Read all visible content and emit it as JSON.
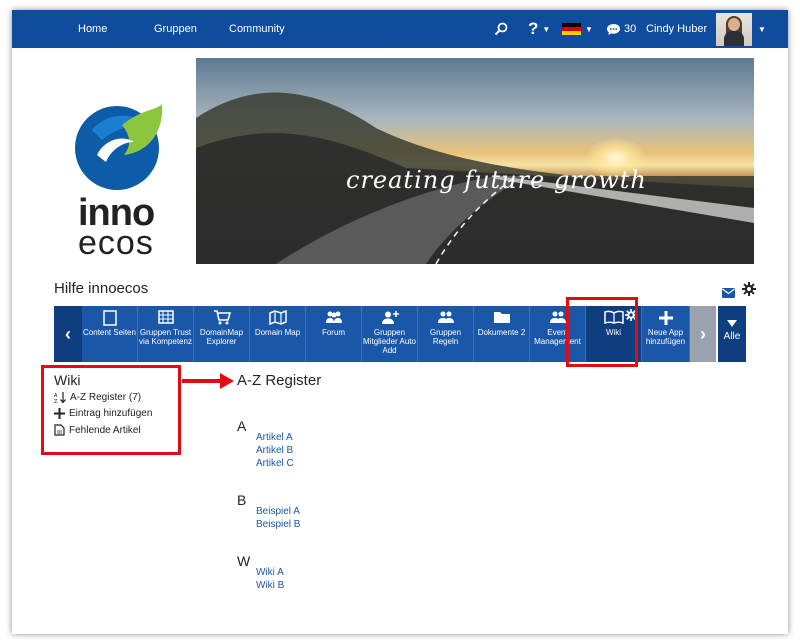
{
  "topnav": {
    "items": [
      "Home",
      "Gruppen",
      "Community"
    ],
    "help_label": "?",
    "chat_count": "30",
    "user_name": "Cindy Huber"
  },
  "icons": {
    "search": "search-icon",
    "help": "help-icon",
    "language": "germany-flag-icon",
    "chat": "chat-icon",
    "mail": "mail-icon",
    "settings": "gear-icon"
  },
  "colors": {
    "primary": "#0f4c9e",
    "tile": "#1a57a8",
    "highlight": "#e10a17",
    "link": "#1a57a8"
  },
  "logo": {
    "line1": "inno",
    "line2": "ecos"
  },
  "banner": {
    "slogan": "creating future growth"
  },
  "group": {
    "title": "Hilfe innoecos"
  },
  "apps": {
    "tiles": [
      "Content Seiten",
      "Gruppen Trust via Kompetenz",
      "DomainMap Explorer",
      "Domain Map",
      "Forum",
      "Gruppen Mitglieder Auto Add",
      "Gruppen Regeln",
      "Dokumente 2",
      "Event Management",
      "Wiki",
      "Neue App hinzufügen"
    ],
    "all_label": "Alle"
  },
  "sidebar": {
    "title": "Wiki",
    "items": [
      "A-Z Register (7)",
      "Eintrag hinzufügen",
      "Fehlende Artikel"
    ]
  },
  "register": {
    "title": "A-Z Register",
    "groups": [
      {
        "letter": "A",
        "articles": [
          "Artikel A",
          "Artikel B",
          "Artikel C"
        ]
      },
      {
        "letter": "B",
        "articles": [
          "Beispiel A",
          "Beispiel B"
        ]
      },
      {
        "letter": "W",
        "articles": [
          "Wiki A",
          "Wiki B"
        ]
      }
    ]
  }
}
